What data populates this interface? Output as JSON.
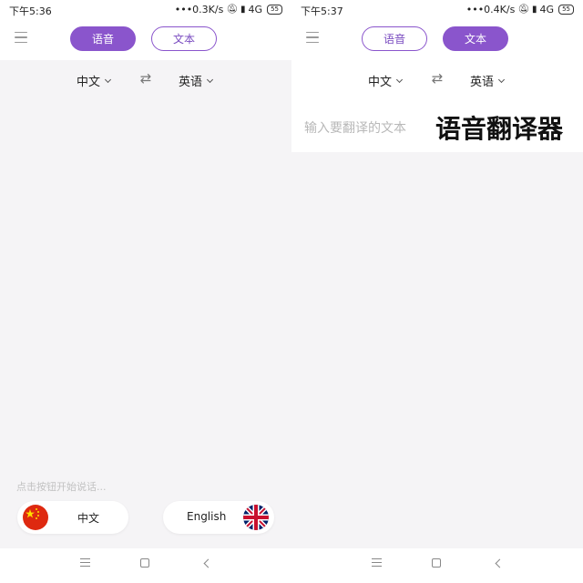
{
  "screens": [
    {
      "status": {
        "time": "下午5:36",
        "net": "•••0.3K/s",
        "signal": "4G",
        "battery": "55"
      },
      "tabs": [
        {
          "label": "语音"
        },
        {
          "label": "文本"
        }
      ],
      "lang_from": "中文",
      "lang_to": "英语",
      "hint": "点击按钮开始说话...",
      "btn_cn_label": "中文",
      "btn_en_label": "English"
    },
    {
      "status": {
        "time": "下午5:37",
        "net": "•••0.4K/s",
        "signal": "4G",
        "battery": "55"
      },
      "tabs": [
        {
          "label": "语音"
        },
        {
          "label": "文本"
        }
      ],
      "lang_from": "中文",
      "lang_to": "英语",
      "input_placeholder": "输入要翻译的文本",
      "overlay_title": "语音翻译器"
    }
  ],
  "colors": {
    "accent": "#8a55cc",
    "background": "#f5f4f6"
  },
  "icons": {
    "menu": "menu-icon",
    "swap": "swap-arrows-icon",
    "chevron": "chevron-down-icon",
    "flag_cn": "china-flag-icon",
    "flag_uk": "uk-flag-icon"
  }
}
